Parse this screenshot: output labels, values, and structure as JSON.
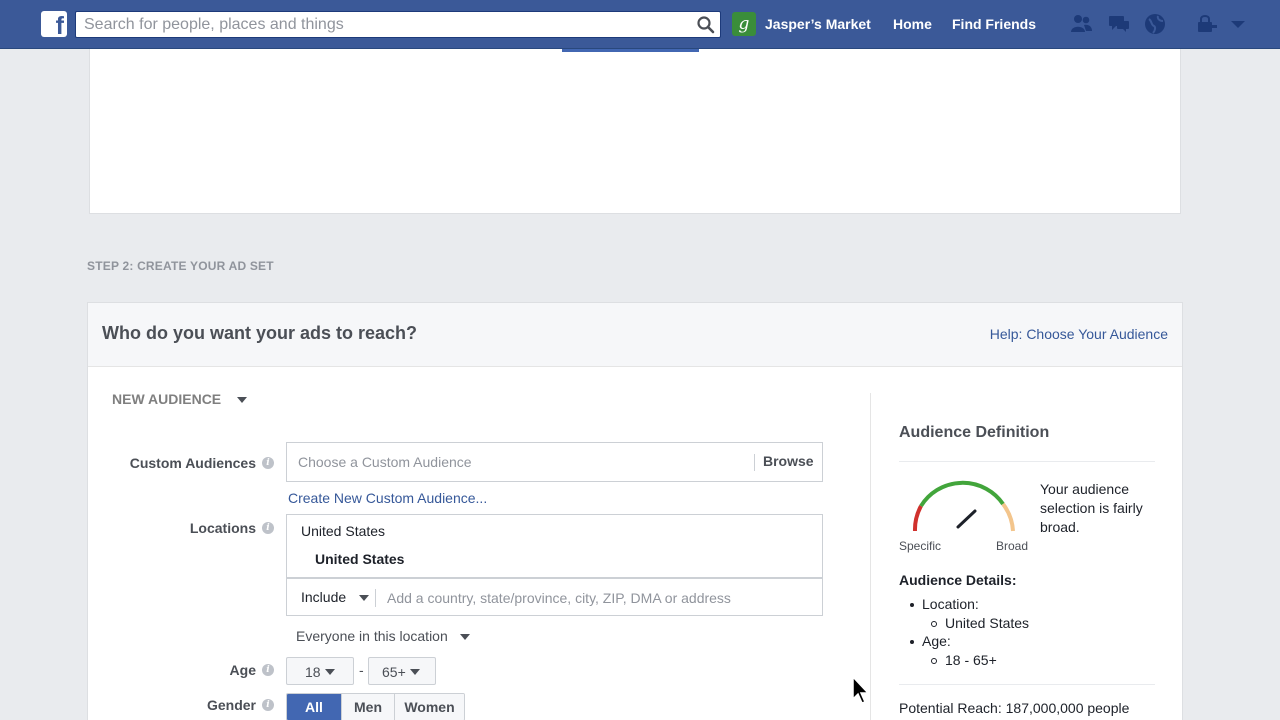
{
  "topbar": {
    "logo": "f",
    "search_placeholder": "Search for people, places and things",
    "page_initial": "g",
    "page_name": "Jasper’s Market",
    "home": "Home",
    "find_friends": "Find Friends"
  },
  "step_label": "STEP 2: CREATE YOUR AD SET",
  "card": {
    "title": "Who do you want your ads to reach?",
    "help_link": "Help: Choose Your Audience",
    "audience_select": "NEW AUDIENCE",
    "custom_audiences_label": "Custom Audiences",
    "custom_audiences_placeholder": "Choose a Custom Audience",
    "browse": "Browse",
    "create_custom_audience": "Create New Custom Audience...",
    "locations_label": "Locations",
    "location_group": "United States",
    "location_item": "United States",
    "include": "Include",
    "location_placeholder": "Add a country, state/province, city, ZIP, DMA or address",
    "everyone": "Everyone in this location",
    "age_label": "Age",
    "age_min": "18",
    "age_max": "65+",
    "age_dash": "-",
    "gender_label": "Gender",
    "gender_all": "All",
    "gender_men": "Men",
    "gender_women": "Women"
  },
  "audience_definition": {
    "title": "Audience Definition",
    "gauge_specific": "Specific",
    "gauge_broad": "Broad",
    "gauge_text": "Your audience selection is fairly broad.",
    "details_title": "Audience Details:",
    "location_label": "Location:",
    "location_value": "United States",
    "age_label": "Age:",
    "age_value": "18 - 65+",
    "potential_reach": "Potential Reach: 187,000,000 people"
  },
  "colors": {
    "topbar": "#3b5998",
    "link": "#365899",
    "active_button": "#4267b2"
  }
}
